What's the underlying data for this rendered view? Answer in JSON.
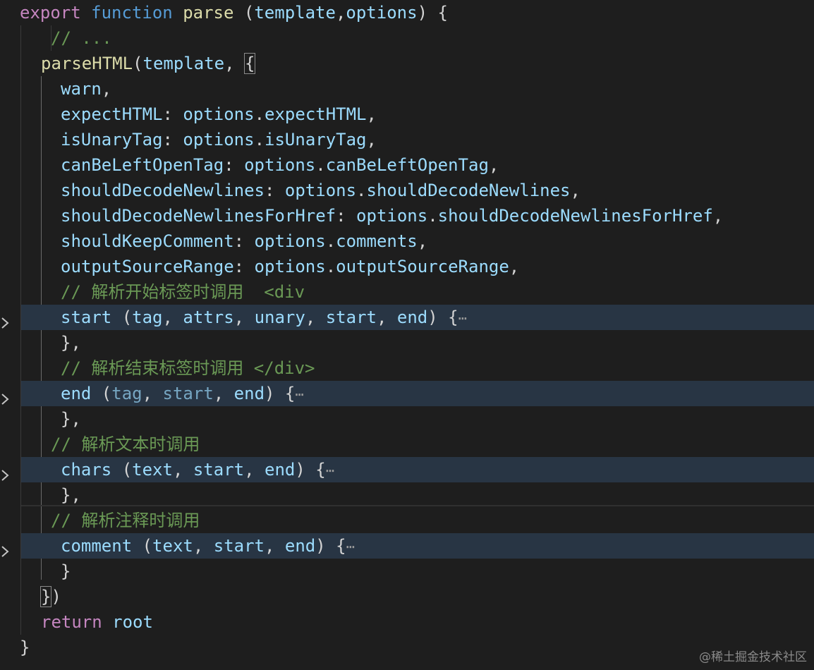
{
  "lines": [
    [
      {
        "t": "export ",
        "c": "kw"
      },
      {
        "t": "function ",
        "c": "st"
      },
      {
        "t": "parse ",
        "c": "fn"
      },
      {
        "t": "(",
        "c": "pn"
      },
      {
        "t": "template",
        "c": "pr"
      },
      {
        "t": ",",
        "c": "pn"
      },
      {
        "t": "options",
        "c": "pr"
      },
      {
        "t": ") {",
        "c": "pn"
      }
    ],
    [
      {
        "t": "// ...",
        "c": "cm"
      }
    ],
    [
      {
        "t": "parseHTML",
        "c": "fn"
      },
      {
        "t": "(",
        "c": "pn"
      },
      {
        "t": "template",
        "c": "pr"
      },
      {
        "t": ", ",
        "c": "pn"
      },
      {
        "t": "{",
        "c": "pn bracket-match"
      }
    ],
    [
      {
        "t": "warn",
        "c": "pr"
      },
      {
        "t": ",",
        "c": "pn"
      }
    ],
    [
      {
        "t": "expectHTML",
        "c": "pr"
      },
      {
        "t": ": ",
        "c": "pn"
      },
      {
        "t": "options",
        "c": "pr"
      },
      {
        "t": ".",
        "c": "pn"
      },
      {
        "t": "expectHTML",
        "c": "pr"
      },
      {
        "t": ",",
        "c": "pn"
      }
    ],
    [
      {
        "t": "isUnaryTag",
        "c": "pr"
      },
      {
        "t": ": ",
        "c": "pn"
      },
      {
        "t": "options",
        "c": "pr"
      },
      {
        "t": ".",
        "c": "pn"
      },
      {
        "t": "isUnaryTag",
        "c": "pr"
      },
      {
        "t": ",",
        "c": "pn"
      }
    ],
    [
      {
        "t": "canBeLeftOpenTag",
        "c": "pr"
      },
      {
        "t": ": ",
        "c": "pn"
      },
      {
        "t": "options",
        "c": "pr"
      },
      {
        "t": ".",
        "c": "pn"
      },
      {
        "t": "canBeLeftOpenTag",
        "c": "pr"
      },
      {
        "t": ",",
        "c": "pn"
      }
    ],
    [
      {
        "t": "shouldDecodeNewlines",
        "c": "pr"
      },
      {
        "t": ": ",
        "c": "pn"
      },
      {
        "t": "options",
        "c": "pr"
      },
      {
        "t": ".",
        "c": "pn"
      },
      {
        "t": "shouldDecodeNewlines",
        "c": "pr"
      },
      {
        "t": ",",
        "c": "pn"
      }
    ],
    [
      {
        "t": "shouldDecodeNewlinesForHref",
        "c": "pr"
      },
      {
        "t": ": ",
        "c": "pn"
      },
      {
        "t": "options",
        "c": "pr"
      },
      {
        "t": ".",
        "c": "pn"
      },
      {
        "t": "shouldDecodeNewlinesForHref",
        "c": "pr"
      },
      {
        "t": ",",
        "c": "pn"
      }
    ],
    [
      {
        "t": "shouldKeepComment",
        "c": "pr"
      },
      {
        "t": ": ",
        "c": "pn"
      },
      {
        "t": "options",
        "c": "pr"
      },
      {
        "t": ".",
        "c": "pn"
      },
      {
        "t": "comments",
        "c": "pr"
      },
      {
        "t": ",",
        "c": "pn"
      }
    ],
    [
      {
        "t": "outputSourceRange",
        "c": "pr"
      },
      {
        "t": ": ",
        "c": "pn"
      },
      {
        "t": "options",
        "c": "pr"
      },
      {
        "t": ".",
        "c": "pn"
      },
      {
        "t": "outputSourceRange",
        "c": "pr"
      },
      {
        "t": ",",
        "c": "pn"
      }
    ],
    [
      {
        "t": "// 解析开始标签时调用  <div",
        "c": "cm"
      }
    ],
    [
      {
        "t": "start ",
        "c": "pr"
      },
      {
        "t": "(",
        "c": "pn"
      },
      {
        "t": "tag",
        "c": "pr"
      },
      {
        "t": ", ",
        "c": "pn"
      },
      {
        "t": "attrs",
        "c": "pr"
      },
      {
        "t": ", ",
        "c": "pn"
      },
      {
        "t": "unary",
        "c": "pr"
      },
      {
        "t": ", ",
        "c": "pn"
      },
      {
        "t": "start",
        "c": "pr"
      },
      {
        "t": ", ",
        "c": "pn"
      },
      {
        "t": "end",
        "c": "pr"
      },
      {
        "t": ") {",
        "c": "pn"
      },
      {
        "t": "⋯",
        "c": "dots"
      }
    ],
    [
      {
        "t": "},",
        "c": "pn"
      }
    ],
    [
      {
        "t": "// 解析结束标签时调用 </div>",
        "c": "cm"
      }
    ],
    [
      {
        "t": "end ",
        "c": "pr"
      },
      {
        "t": "(",
        "c": "pn"
      },
      {
        "t": "tag",
        "c": "dim"
      },
      {
        "t": ", ",
        "c": "pn"
      },
      {
        "t": "start",
        "c": "dim"
      },
      {
        "t": ", ",
        "c": "pn"
      },
      {
        "t": "end",
        "c": "pr"
      },
      {
        "t": ") {",
        "c": "pn"
      },
      {
        "t": "⋯",
        "c": "dots"
      }
    ],
    [
      {
        "t": "},",
        "c": "pn"
      }
    ],
    [
      {
        "t": "// 解析文本时调用",
        "c": "cm"
      }
    ],
    [
      {
        "t": "chars ",
        "c": "pr"
      },
      {
        "t": "(",
        "c": "pn"
      },
      {
        "t": "text",
        "c": "pr"
      },
      {
        "t": ", ",
        "c": "pn"
      },
      {
        "t": "start",
        "c": "pr"
      },
      {
        "t": ", ",
        "c": "pn"
      },
      {
        "t": "end",
        "c": "pr"
      },
      {
        "t": ") {",
        "c": "pn"
      },
      {
        "t": "⋯",
        "c": "dots"
      }
    ],
    [
      {
        "t": "},",
        "c": "pn"
      }
    ],
    [
      {
        "t": "// 解析注释时调用",
        "c": "cm"
      }
    ],
    [
      {
        "t": "comment ",
        "c": "pr"
      },
      {
        "t": "(",
        "c": "pn"
      },
      {
        "t": "text",
        "c": "pr"
      },
      {
        "t": ", ",
        "c": "pn"
      },
      {
        "t": "start",
        "c": "pr"
      },
      {
        "t": ", ",
        "c": "pn"
      },
      {
        "t": "end",
        "c": "pr"
      },
      {
        "t": ") {",
        "c": "pn"
      },
      {
        "t": "⋯",
        "c": "dots"
      }
    ],
    [
      {
        "t": "}",
        "c": "pn"
      }
    ],
    [
      {
        "t": "}",
        "c": "pn bracket-match"
      },
      {
        "t": ")",
        "c": "pn"
      }
    ],
    [
      {
        "t": "return ",
        "c": "kw"
      },
      {
        "t": "root",
        "c": "pr"
      }
    ],
    [
      {
        "t": "}",
        "c": "pn"
      }
    ]
  ],
  "folded_lines": [
    12,
    15,
    18,
    21
  ],
  "highlighted_lines": [
    12,
    15,
    18,
    21
  ],
  "watermark": "@稀土掘金技术社区",
  "colors": {
    "background": "#1e1e1e",
    "keyword": "#c586c0",
    "storage": "#569cd6",
    "function": "#dcdcaa",
    "property": "#9cdcfe",
    "comment": "#6a9955",
    "folded_highlight": "#283544"
  },
  "icons": {
    "fold": "chevron-right-icon"
  }
}
